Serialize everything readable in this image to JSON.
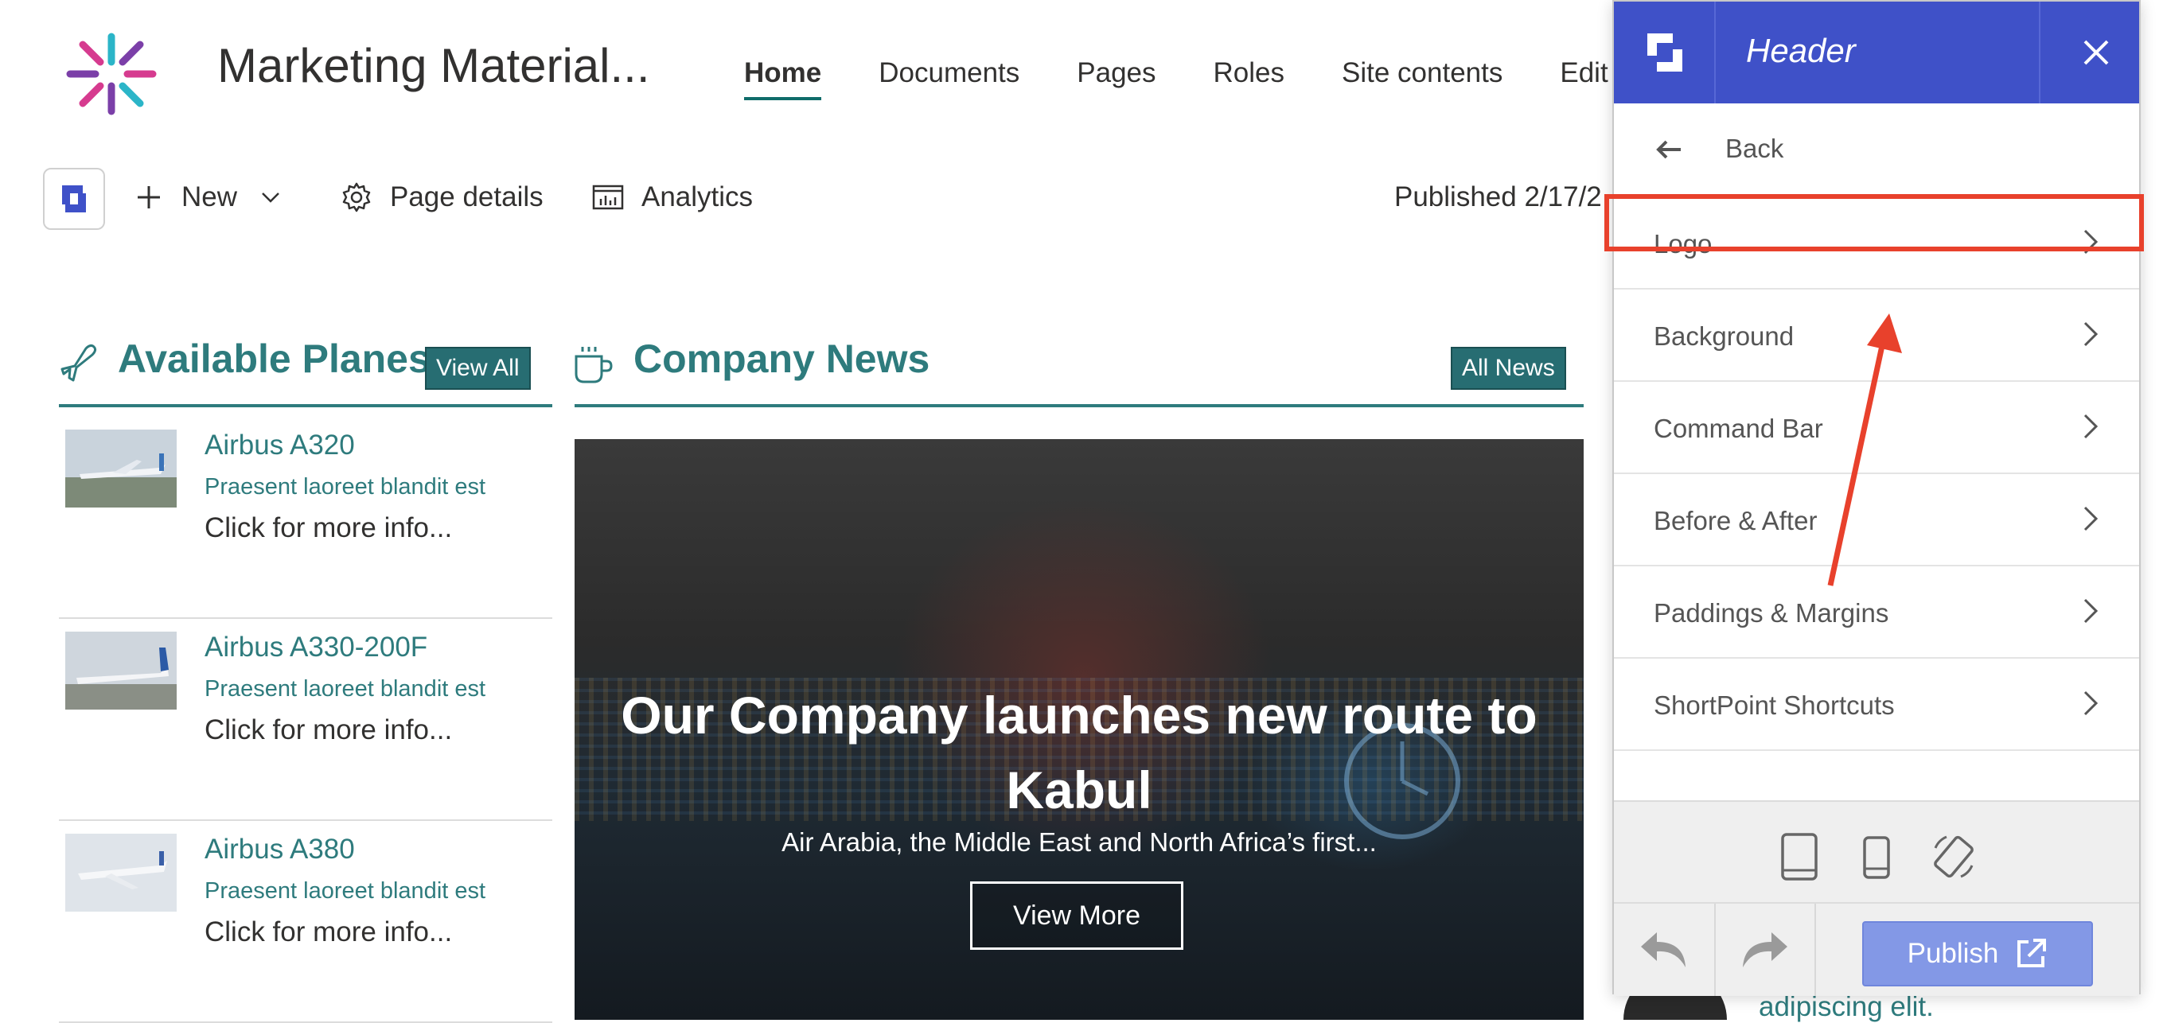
{
  "site": {
    "title": "Marketing Material...",
    "nav": [
      "Home",
      "Documents",
      "Pages",
      "Roles",
      "Site contents",
      "Edit"
    ]
  },
  "command_bar": {
    "new_label": "New",
    "page_details_label": "Page details",
    "analytics_label": "Analytics",
    "published_text": "Published 2/17/2"
  },
  "planes": {
    "title": "Available Planes",
    "view_all": "View All",
    "items": [
      {
        "name": "Airbus A320",
        "desc": "Praesent laoreet blandit est",
        "more": "Click for more info..."
      },
      {
        "name": "Airbus A330-200F",
        "desc": "Praesent laoreet blandit est",
        "more": "Click for more info..."
      },
      {
        "name": "Airbus A380",
        "desc": "Praesent laoreet blandit est",
        "more": "Click for more info..."
      }
    ]
  },
  "news": {
    "title": "Company News",
    "all_news": "All News",
    "hero_title": "Our Company launches new route to Kabul",
    "hero_sub": "Air Arabia, the Middle East and North Africa’s first...",
    "view_more": "View More"
  },
  "panel": {
    "title": "Header",
    "back": "Back",
    "items": [
      "Logo",
      "Background",
      "Command Bar",
      "Before & After",
      "Paddings & Margins",
      "ShortPoint Shortcuts"
    ],
    "publish": "Publish"
  },
  "peek_text": "adipiscing elit.",
  "colors": {
    "accent": "#2e7b7d",
    "panel_header": "#3f51c8",
    "publish": "#8398e6",
    "annotation": "#e8412c"
  }
}
